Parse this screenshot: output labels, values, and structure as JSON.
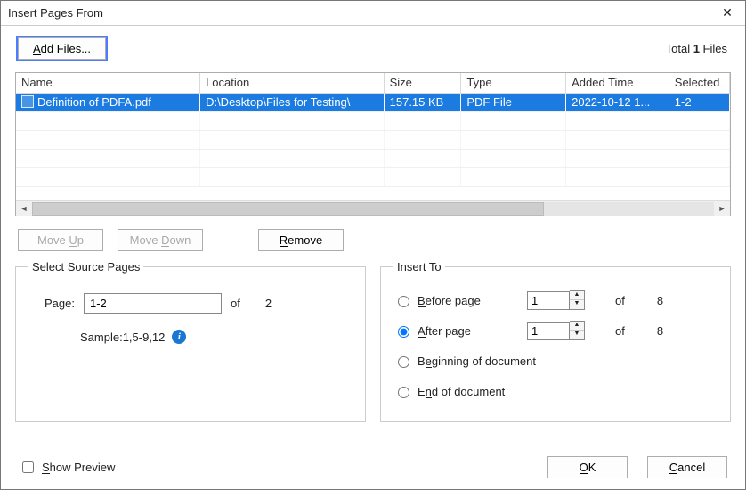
{
  "window": {
    "title": "Insert Pages From"
  },
  "toolbar": {
    "add_files_label": "Add Files...",
    "total_prefix": "Total ",
    "total_count": "1",
    "total_suffix": " Files"
  },
  "table": {
    "headers": {
      "name": "Name",
      "location": "Location",
      "size": "Size",
      "type": "Type",
      "added": "Added Time",
      "selected": "Selected"
    },
    "rows": [
      {
        "name": "Definition of PDFA.pdf",
        "location": "D:\\Desktop\\Files for Testing\\",
        "size": "157.15 KB",
        "type": "PDF File",
        "added": "2022-10-12 1...",
        "selected": "1-2"
      }
    ]
  },
  "buttons": {
    "move_up": "Move Up",
    "move_down": "Move Down",
    "remove": "Remove",
    "ok": "OK",
    "cancel": "Cancel"
  },
  "source": {
    "legend": "Select Source Pages",
    "page_label": "Page:",
    "page_value": "1-2",
    "of_label": "of",
    "of_value": "2",
    "sample_label": "Sample:1,5-9,12"
  },
  "insert": {
    "legend": "Insert To",
    "before_label": "Before page",
    "before_value": "1",
    "before_of": "of",
    "before_total": "8",
    "after_label": "After page",
    "after_value": "1",
    "after_of": "of",
    "after_total": "8",
    "beginning_label": "Beginning of document",
    "end_label": "End of document"
  },
  "footer": {
    "show_preview_label": "Show Preview"
  }
}
